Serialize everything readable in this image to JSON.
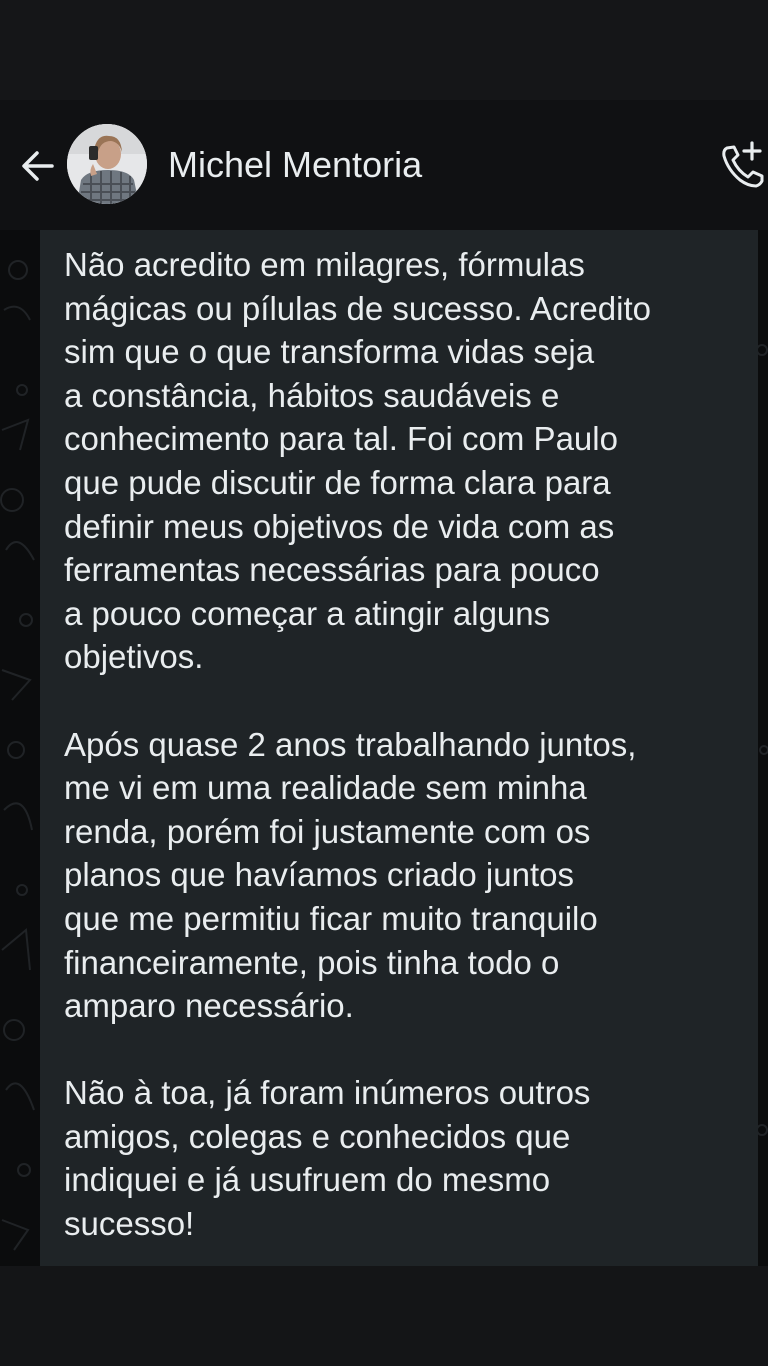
{
  "header": {
    "contact_name": "Michel Mentoria",
    "back_icon": "arrow-left-icon",
    "call_icon": "phone-plus-icon"
  },
  "message": {
    "paragraphs": [
      "Não acredito em milagres, fórmulas\nmágicas ou pílulas de sucesso. Acredito\nsim que o que transforma vidas seja\na constância, hábitos saudáveis e\nconhecimento para tal. Foi com Paulo\nque pude discutir de forma clara para\ndefinir meus objetivos de vida com as\nferramentas necessárias para pouco\na pouco começar a atingir alguns\nobjetivos.",
      "Após quase 2 anos trabalhando juntos,\nme vi em uma realidade sem minha\nrenda, porém foi justamente com os\nplanos que havíamos criado juntos\nque me permitiu ficar muito tranquilo\nfinanceiramente, pois tinha todo o\namparo necessário.",
      "Não à toa, já foram inúmeros outros\namigos, colegas e conhecidos que\nindiquei e já usufruem do mesmo\nsucesso!"
    ]
  },
  "colors": {
    "header_bg": "#101113",
    "bubble_bg": "#1f2427",
    "text": "#e9edef"
  }
}
